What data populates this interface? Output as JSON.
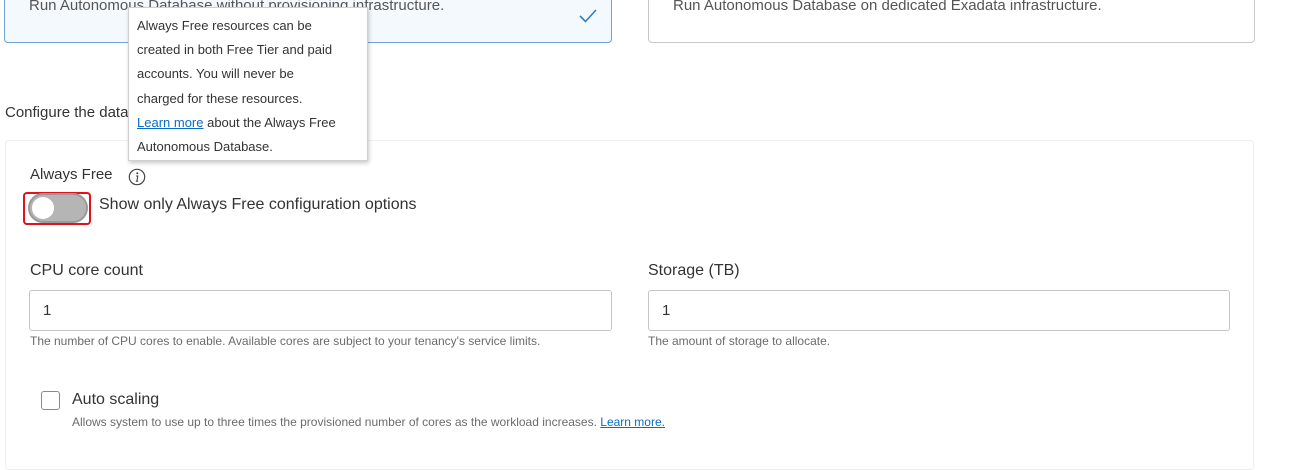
{
  "cards": {
    "shared": {
      "description": "Run Autonomous Database without provisioning infrastructure.",
      "selected": true
    },
    "dedicated": {
      "description": "Run Autonomous Database on dedicated Exadata infrastructure."
    }
  },
  "section": {
    "heading": "Configure the database"
  },
  "always_free": {
    "label": "Always Free",
    "toggle_label": "Show only Always Free configuration options",
    "toggle_on": false
  },
  "tooltip": {
    "line1": "Always Free resources can be",
    "line2": "created in both Free Tier and paid",
    "line3": "accounts. You will never be",
    "line4": "charged for these resources.",
    "link_text": "Learn more",
    "line5_rest": " about the Always Free",
    "line6": "Autonomous Database."
  },
  "cpu": {
    "label": "CPU core count",
    "value": "1",
    "help": "The number of CPU cores to enable. Available cores are subject to your tenancy's service limits."
  },
  "storage": {
    "label": "Storage (TB)",
    "value": "1",
    "help": "The amount of storage to allocate."
  },
  "auto_scaling": {
    "label": "Auto scaling",
    "checked": false,
    "help": "Allows system to use up to three times the provisioned number of cores as the workload increases. ",
    "link_text": "Learn more."
  },
  "colors": {
    "accent": "#0a6cc4",
    "highlight": "#e0121a",
    "selected_card_border": "#6fa4d8"
  },
  "icons": {
    "check": "check-icon",
    "info": "info-icon"
  }
}
